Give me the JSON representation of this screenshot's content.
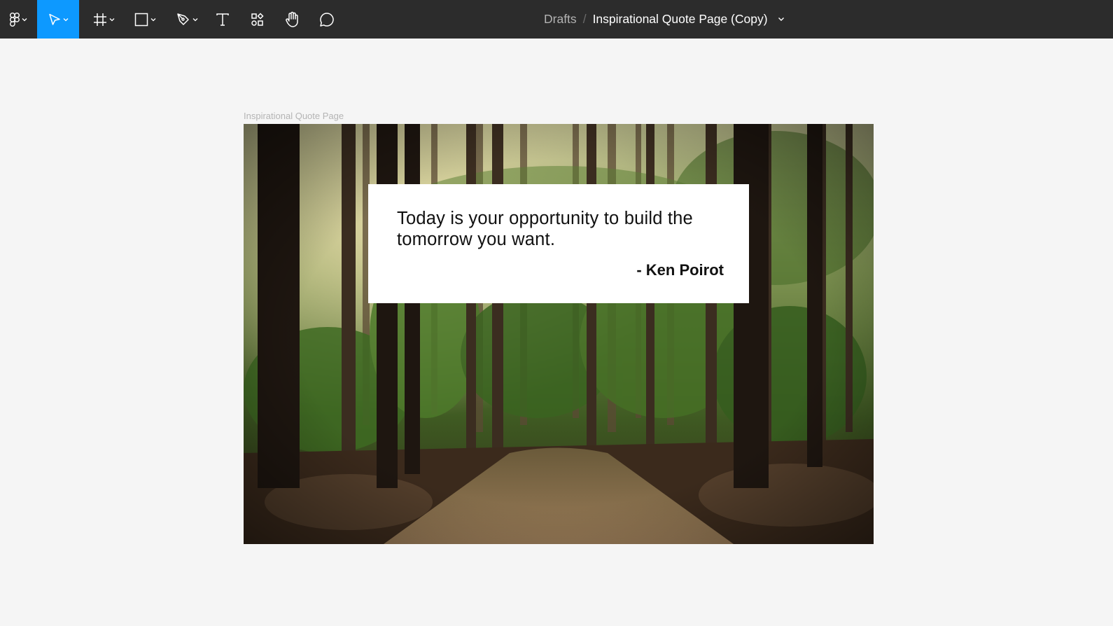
{
  "toolbar": {
    "tools": [
      {
        "name": "main-menu",
        "icon": "figma-logo-icon",
        "has_dropdown": true
      },
      {
        "name": "move-tool",
        "icon": "cursor-arrow-icon",
        "has_dropdown": true,
        "active": true
      },
      {
        "name": "frame-tool",
        "icon": "frame-hash-icon",
        "has_dropdown": true
      },
      {
        "name": "shape-tool",
        "icon": "rectangle-icon",
        "has_dropdown": true
      },
      {
        "name": "pen-tool",
        "icon": "pen-icon",
        "has_dropdown": true
      },
      {
        "name": "text-tool",
        "icon": "text-icon",
        "has_dropdown": false
      },
      {
        "name": "resources-tool",
        "icon": "components-icon",
        "has_dropdown": false
      },
      {
        "name": "hand-tool",
        "icon": "hand-icon",
        "has_dropdown": false
      },
      {
        "name": "comment-tool",
        "icon": "comment-icon",
        "has_dropdown": false
      }
    ],
    "accent_color": "#0d99ff",
    "background_color": "#2c2c2c"
  },
  "breadcrumb": {
    "folder": "Drafts",
    "separator": "/",
    "file_name": "Inspirational Quote Page (Copy)"
  },
  "canvas": {
    "background_color": "#f5f5f5",
    "frame": {
      "label": "Inspirational Quote Page",
      "image": "forest-path-photo",
      "quote": {
        "text": "Today is your opportunity to build the tomorrow you want.",
        "author": "- Ken Poirot"
      }
    }
  }
}
